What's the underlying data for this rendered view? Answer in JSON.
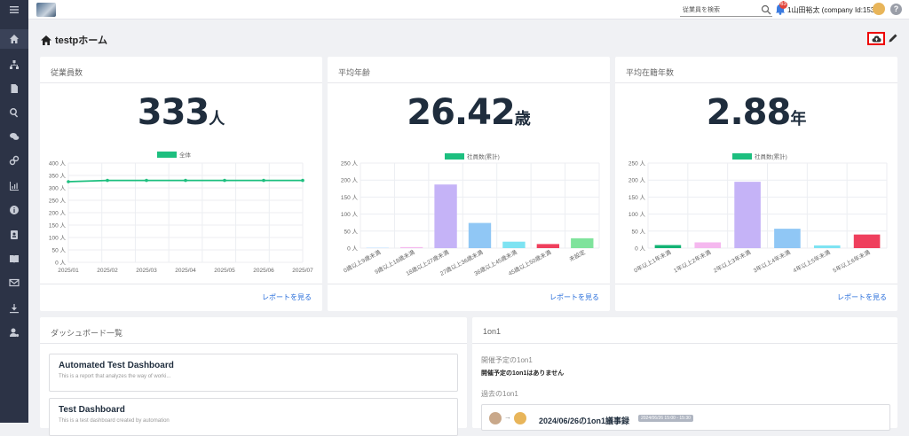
{
  "sidebar": {
    "items": [
      "menu-icon",
      "home-icon",
      "org-chart-icon",
      "document-icon",
      "search-icon",
      "chat-icon",
      "link-icon",
      "line-chart-icon",
      "info-icon",
      "contact-card-icon",
      "book-icon",
      "mail-icon",
      "download-icon",
      "user-settings-icon"
    ],
    "active": "home-icon"
  },
  "header": {
    "search_placeholder": "従業員を検索",
    "notification_count": "63",
    "user_label": "1山田裕太 (company Id:153)",
    "help_label": "?"
  },
  "page": {
    "title": "testpホーム"
  },
  "cards": [
    {
      "title": "従業員数",
      "value": "333",
      "unit": "人",
      "report": "レポートを見る"
    },
    {
      "title": "平均年齢",
      "value": "26.42",
      "unit": "歳",
      "report": "レポートを見る"
    },
    {
      "title": "平均在籍年数",
      "value": "2.88",
      "unit": "年",
      "report": "レポートを見る"
    }
  ],
  "chart_data": [
    {
      "type": "line",
      "legend": [
        "全体"
      ],
      "categories": [
        "2025/01",
        "2025/02",
        "2025/03",
        "2025/04",
        "2025/05",
        "2025/06",
        "2025/07"
      ],
      "series": [
        {
          "name": "全体",
          "values": [
            325,
            330,
            330,
            330,
            330,
            330,
            330
          ]
        }
      ],
      "ylim": [
        0,
        400
      ],
      "yticks": [
        "0 人",
        "50 人",
        "100 人",
        "150 人",
        "200 人",
        "250 人",
        "300 人",
        "350 人",
        "400 人"
      ],
      "color": "#1dbf7f",
      "grid": true,
      "legend_position": "top"
    },
    {
      "type": "bar",
      "legend": [
        "社員数(累計)"
      ],
      "categories": [
        "0歳以上9歳未満",
        "9歳以上18歳未満",
        "18歳以上27歳未満",
        "27歳以上36歳未満",
        "36歳以上45歳未満",
        "45歳以上50歳未満",
        "未設定"
      ],
      "values": [
        1,
        3,
        187,
        74,
        19,
        12,
        29
      ],
      "colors": [
        "#a8d8ff",
        "#f5b8ef",
        "#c5b3f7",
        "#90c7f5",
        "#7ee3f2",
        "#ef3f5d",
        "#7fe39c"
      ],
      "ylim": [
        0,
        250
      ],
      "yticks": [
        "0 人",
        "50 人",
        "100 人",
        "150 人",
        "200 人",
        "250 人"
      ],
      "grid": true,
      "legend_position": "top"
    },
    {
      "type": "bar",
      "legend": [
        "社員数(累計)"
      ],
      "categories": [
        "0年以上1年未満",
        "1年以上2年未満",
        "2年以上3年未満",
        "3年以上4年未満",
        "4年以上5年未満",
        "5年以上6年未満"
      ],
      "values": [
        9,
        17,
        195,
        57,
        8,
        40
      ],
      "colors": [
        "#13b374",
        "#f5b8ef",
        "#c5b3f7",
        "#90c7f5",
        "#7ee3f2",
        "#ef3f5d"
      ],
      "ylim": [
        0,
        250
      ],
      "yticks": [
        "0 人",
        "50 人",
        "100 人",
        "150 人",
        "200 人",
        "250 人"
      ],
      "grid": true,
      "legend_position": "top"
    }
  ],
  "dashboards": {
    "title": "ダッシュボード一覧",
    "items": [
      {
        "title": "Automated Test Dashboard",
        "desc": "This is a report that analyzes the way of worki..."
      },
      {
        "title": "Test Dashboard",
        "desc": "This is a test dashboard created by automation"
      }
    ]
  },
  "oneonone": {
    "title": "1on1",
    "upcoming_label": "開催予定の1on1",
    "upcoming_none": "開催予定の1on1はありません",
    "past_label": "過去の1on1",
    "item_title": "2024/06/26の1on1議事録",
    "item_tag": "2024/06/26 15:00 - 15:30"
  }
}
